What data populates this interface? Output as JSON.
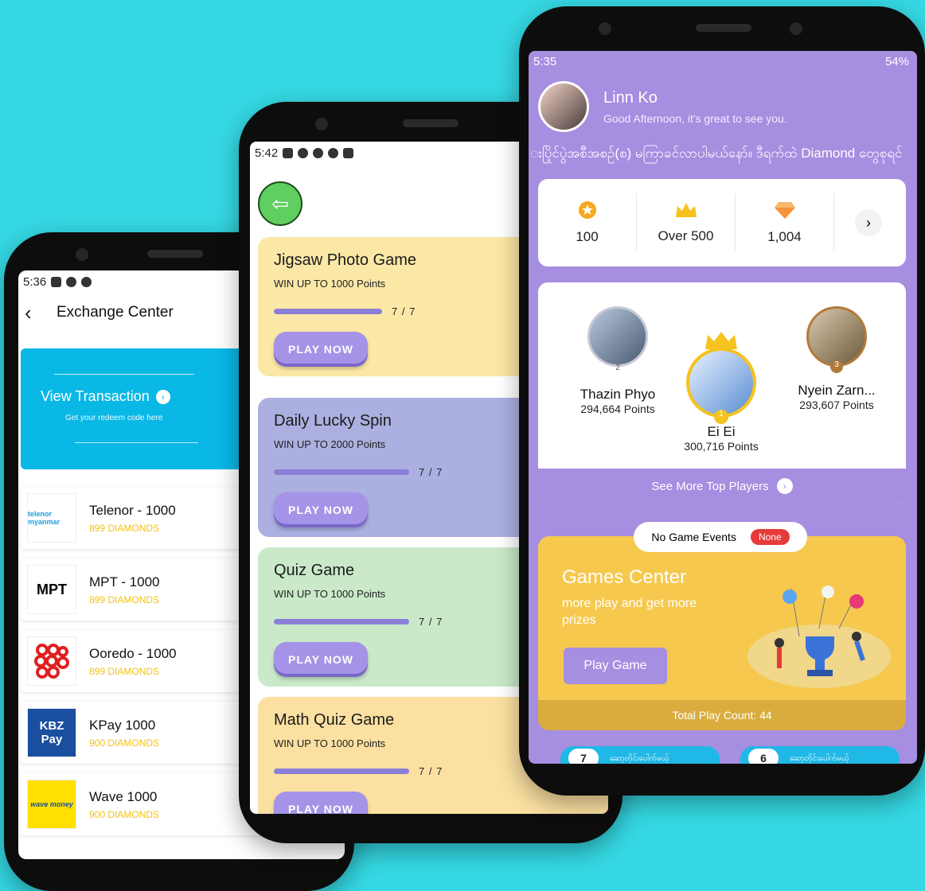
{
  "exchange": {
    "status_time": "5:36",
    "header_title": "Exchange Center",
    "view_transaction": {
      "title": "View Transaction",
      "subtitle": "Get your redeem code here"
    },
    "items": [
      {
        "name": "Telenor - 1000",
        "cost": "899 DIAMONDS",
        "logo_text": "telenor myanmar",
        "logo_color": "#1aa0e6"
      },
      {
        "name": "MPT - 1000",
        "cost": "899 DIAMONDS",
        "logo_text": "MPT",
        "logo_color": "#111111"
      },
      {
        "name": "Ooredo - 1000",
        "cost": "899 DIAMONDS",
        "logo_text": "",
        "logo_color": "#e02020"
      },
      {
        "name": "KPay 1000",
        "cost": "900 DIAMONDS",
        "logo_text": "KBZ Pay",
        "logo_color": "#1a4fa0"
      },
      {
        "name": "Wave 1000",
        "cost": "900 DIAMONDS",
        "logo_text": "wave money",
        "logo_color": "#ffe000"
      }
    ]
  },
  "games": {
    "status_time": "5:42",
    "cards": [
      {
        "title": "Jigsaw Photo Game",
        "subtitle": "WIN UP TO 1000 Points",
        "progress": "7 / 7",
        "button": "PLAY NOW",
        "color": "#fbe8a6"
      },
      {
        "title": "Daily Lucky Spin",
        "subtitle": "WIN UP TO 2000 Points",
        "progress": "7 / 7",
        "button": "PLAY NOW",
        "color": "#abb0e0"
      },
      {
        "title": "Quiz Game",
        "subtitle": "WIN UP TO 1000 Points",
        "progress": "7 / 7",
        "button": "PLAY NOW",
        "color": "#c9e9c9"
      },
      {
        "title": "Math Quiz Game",
        "subtitle": "WIN UP TO 1000 Points",
        "progress": "7 / 7",
        "button": "PLAY NOW",
        "color": "#fbe0a1"
      }
    ]
  },
  "profile": {
    "status_time": "5:35",
    "battery": "54%",
    "name": "Linn Ko",
    "greeting": "Good Afternoon, it's great to see you.",
    "marquee": "းပြိုင်ပွဲအစီအစဥ်(စ) မကြာခင်လာပါမယ်နော်။ ဒီရက်ထဲ Diamond တွေစုရင်",
    "stats": [
      {
        "icon": "star-coin-icon",
        "value": "100"
      },
      {
        "icon": "crown-icon",
        "value": "Over 500"
      },
      {
        "icon": "diamond-icon",
        "value": "1,004"
      }
    ],
    "top_players": [
      {
        "rank": "2",
        "name": "Thazin Phyo",
        "points": "294,664  Points"
      },
      {
        "rank": "1",
        "name": "Ei Ei",
        "points": "300,716  Points"
      },
      {
        "rank": "3",
        "name": "Nyein Zarn...",
        "points": "293,607  Points"
      }
    ],
    "see_more": "See More Top Players",
    "events": {
      "label": "No Game Events",
      "badge": "None"
    },
    "games_center": {
      "title": "Games Center",
      "subtitle": "more play and get more prizes",
      "button": "Play Game",
      "footer": "Total Play Count: 44"
    },
    "mini_cards": [
      {
        "num": "7",
        "text": "ဆော့တိုင်းပေါက်မယ့်"
      },
      {
        "num": "6",
        "text": "ဆော့တိုင်းပေါက်မယ့်"
      }
    ]
  }
}
